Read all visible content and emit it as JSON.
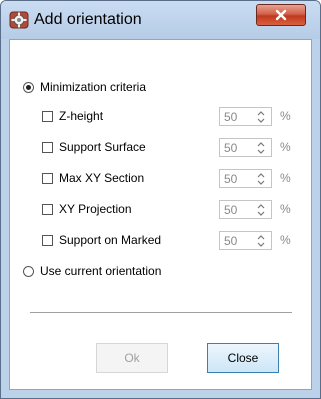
{
  "window": {
    "title": "Add orientation",
    "close_icon": "close-x-icon",
    "app_icon": "gear-icon"
  },
  "options": {
    "minimization": {
      "label": "Minimization criteria",
      "selected": true
    },
    "criteria": [
      {
        "label": "Z-height",
        "checked": false,
        "value": "50",
        "unit": "%"
      },
      {
        "label": "Support Surface",
        "checked": false,
        "value": "50",
        "unit": "%"
      },
      {
        "label": "Max XY Section",
        "checked": false,
        "value": "50",
        "unit": "%"
      },
      {
        "label": "XY Projection",
        "checked": false,
        "value": "50",
        "unit": "%"
      },
      {
        "label": "Support on Marked",
        "checked": false,
        "value": "50",
        "unit": "%"
      }
    ],
    "current": {
      "label": "Use current orientation",
      "selected": false
    }
  },
  "buttons": {
    "ok_label": "Ok",
    "ok_enabled": false,
    "close_label": "Close"
  },
  "colors": {
    "titlebar": "#bcd1ea",
    "close_button": "#c0391f",
    "close_button_border": "#3c7fb1"
  }
}
